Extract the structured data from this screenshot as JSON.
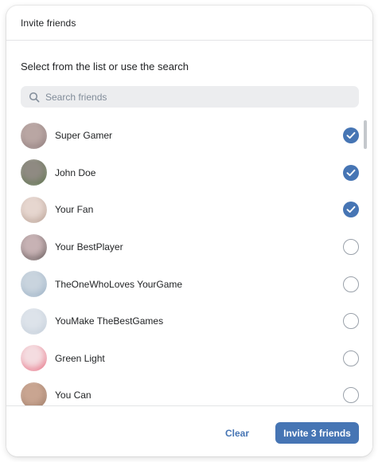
{
  "dialog": {
    "title": "Invite friends",
    "subtitle": "Select from the list or use the search"
  },
  "search": {
    "placeholder": "Search friends",
    "value": "",
    "icon": "search-icon"
  },
  "friends": [
    {
      "name": "Super Gamer",
      "selected": true,
      "avatar_colors": [
        "#b9a6a3",
        "#7d6a6b"
      ]
    },
    {
      "name": "John Doe",
      "selected": true,
      "avatar_colors": [
        "#8f8a82",
        "#4c6e3a"
      ]
    },
    {
      "name": "Your Fan",
      "selected": true,
      "avatar_colors": [
        "#e6d6cf",
        "#a58a7c"
      ]
    },
    {
      "name": "Your BestPlayer",
      "selected": false,
      "avatar_colors": [
        "#c7b2b4",
        "#3c3434"
      ]
    },
    {
      "name": "TheOneWhoLoves YourGame",
      "selected": false,
      "avatar_colors": [
        "#c9d4de",
        "#8aa4bc"
      ]
    },
    {
      "name": "YouMake TheBestGames",
      "selected": false,
      "avatar_colors": [
        "#dde3ea",
        "#b9c5d3"
      ]
    },
    {
      "name": "Green Light",
      "selected": false,
      "avatar_colors": [
        "#f4dce0",
        "#e0425c"
      ]
    },
    {
      "name": "You Can",
      "selected": false,
      "avatar_colors": [
        "#c9a591",
        "#8c6a56"
      ]
    }
  ],
  "footer": {
    "clear_label": "Clear",
    "invite_label": "Invite 3 friends"
  },
  "colors": {
    "accent": "#4675b4",
    "text": "#222426",
    "placeholder": "#818c99",
    "search_bg": "#ecedef"
  }
}
